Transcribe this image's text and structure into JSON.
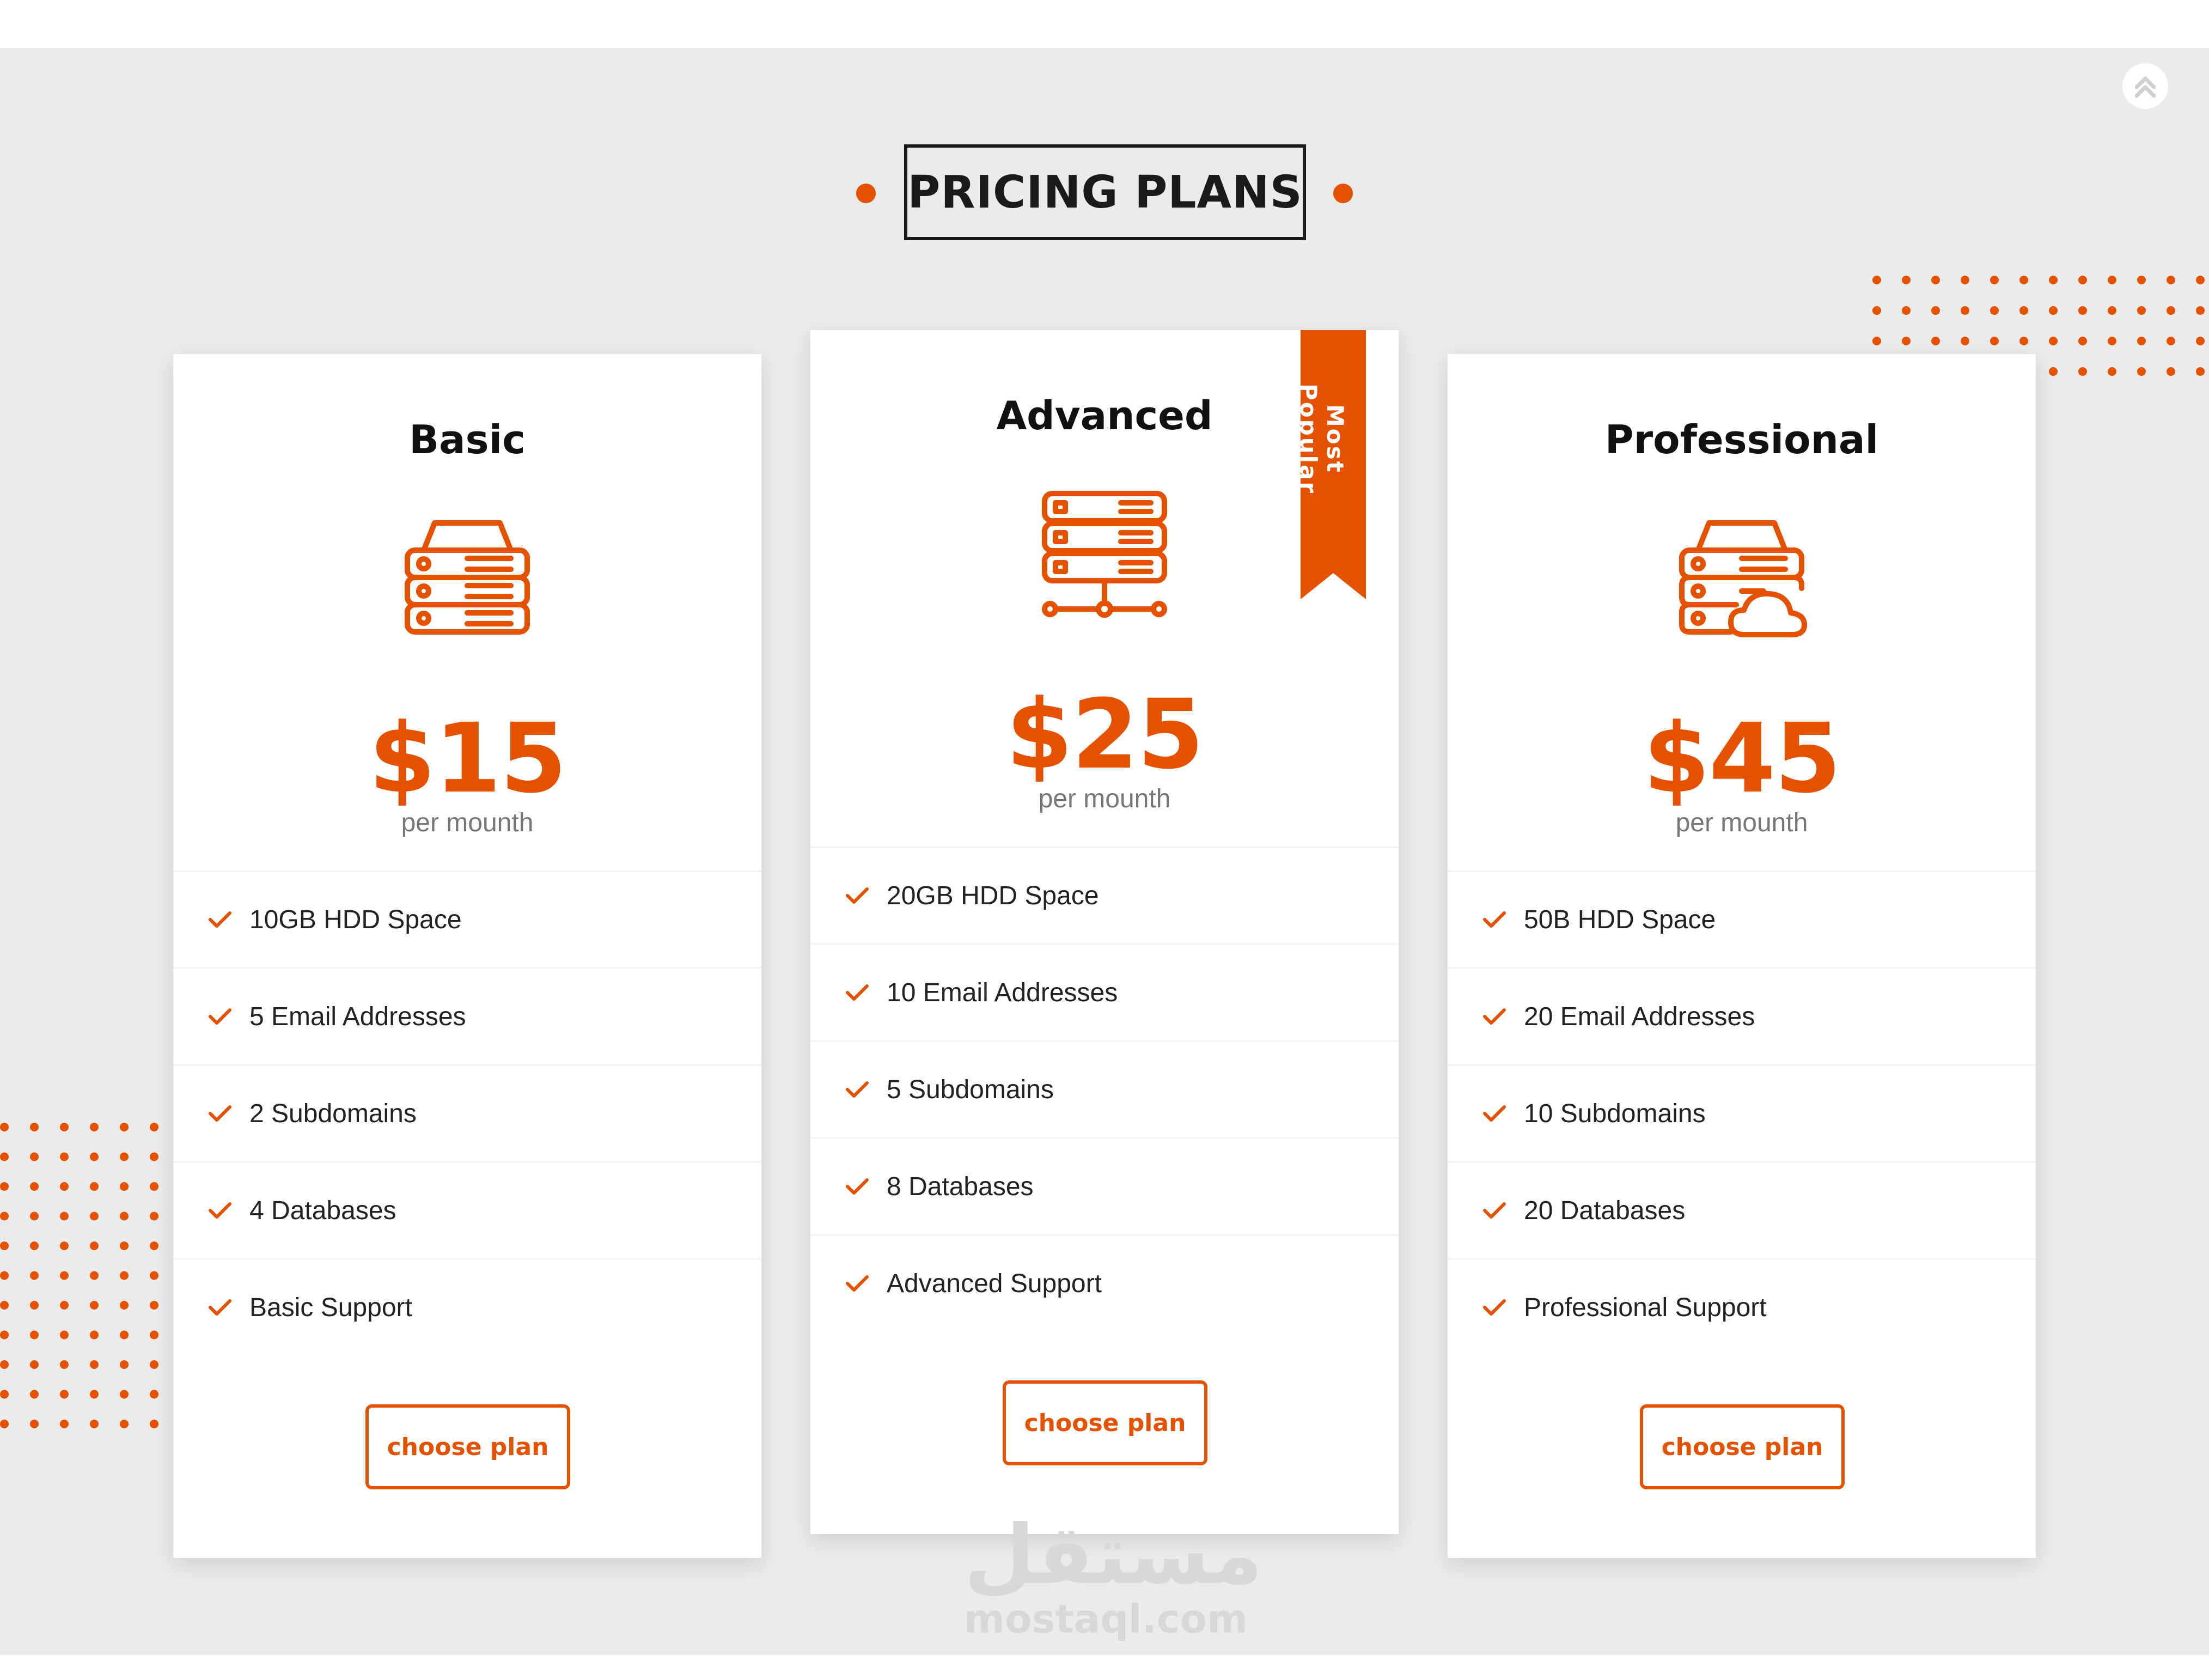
{
  "section_title": "PRICING PLANS",
  "accent_color": "#e65100",
  "plans": [
    {
      "name": "Basic",
      "icon": "server-stack-icon",
      "price": "$15",
      "period": "per mounth",
      "features": [
        "10GB HDD Space",
        "5 Email Addresses",
        "2 Subdomains",
        "4 Databases",
        "Basic Support"
      ],
      "button": "choose plan"
    },
    {
      "name": "Advanced",
      "icon": "server-network-icon",
      "price": "$25",
      "period": "per mounth",
      "badge": "Most Popular",
      "features": [
        "20GB HDD Space",
        "10 Email Addresses",
        "5 Subdomains",
        "8 Databases",
        "Advanced Support"
      ],
      "button": "choose plan"
    },
    {
      "name": "Professional",
      "icon": "server-cloud-icon",
      "price": "$45",
      "period": "per mounth",
      "features": [
        "50B HDD Space",
        "20 Email Addresses",
        "10 Subdomains",
        "20 Databases",
        "Professional Support"
      ],
      "button": "choose plan"
    }
  ],
  "watermark": {
    "logo": "مستقل",
    "url": "mostaql.com"
  },
  "scroll_top_icon": "double-chevron-up-icon"
}
